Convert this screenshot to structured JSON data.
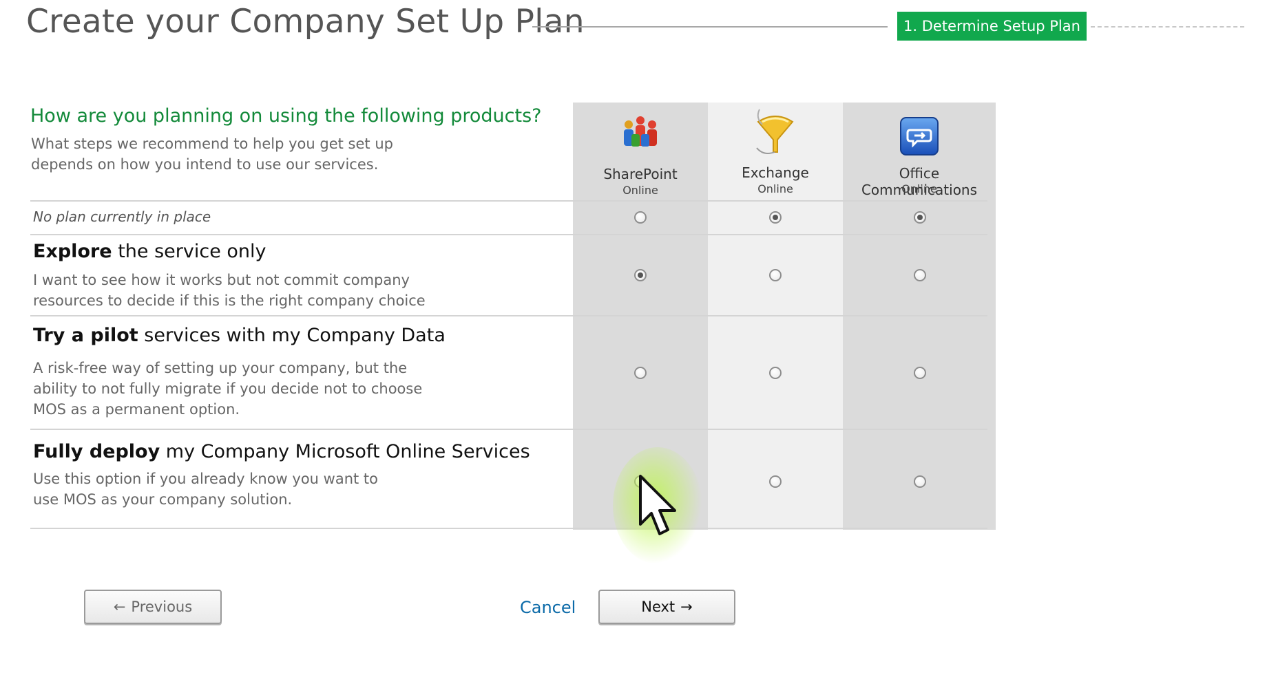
{
  "header": {
    "title": "Create your Company Set Up Plan",
    "step_badge": "1.  Determine Setup Plan",
    "accent_color": "#11a84d"
  },
  "question": {
    "title": "How are you planning on using the following products?",
    "help_line1": "What steps we recommend to help you get set up",
    "help_line2": "depends on how you intend to use our services."
  },
  "products": [
    {
      "name": "SharePoint",
      "sub": "Online",
      "icon": "sharepoint-people-icon"
    },
    {
      "name": "Exchange",
      "sub": "Online",
      "icon": "exchange-funnel-icon"
    },
    {
      "name": "Office Communications",
      "sub": "Online",
      "icon": "office-communications-icon"
    }
  ],
  "options": [
    {
      "id": "none",
      "label": "No plan currently in place",
      "selected": [
        "Exchange",
        "Office Communications"
      ]
    },
    {
      "id": "explore",
      "title_bold": "Explore",
      "title_rest": " the service only",
      "desc_line1": "I want to see how it works but not commit company",
      "desc_line2": "resources to decide if this is the right company choice",
      "selected": [
        "SharePoint"
      ]
    },
    {
      "id": "pilot",
      "title_bold": "Try a pilot",
      "title_rest": " services with my Company Data",
      "desc_line1": "A risk-free way of setting up your company, but the",
      "desc_line2": "ability to not fully migrate if you decide not to choose",
      "desc_line3": "MOS as a permanent option.",
      "selected": []
    },
    {
      "id": "deploy",
      "title_bold": "Fully deploy",
      "title_rest": " my Company Microsoft Online Services",
      "desc_line1": "Use this option  if you already know you want to",
      "desc_line2": "use MOS as your company solution.",
      "selected": []
    }
  ],
  "buttons": {
    "previous": "Previous",
    "previous_arrow": "←",
    "cancel": "Cancel",
    "next": "Next",
    "next_arrow": "→"
  }
}
